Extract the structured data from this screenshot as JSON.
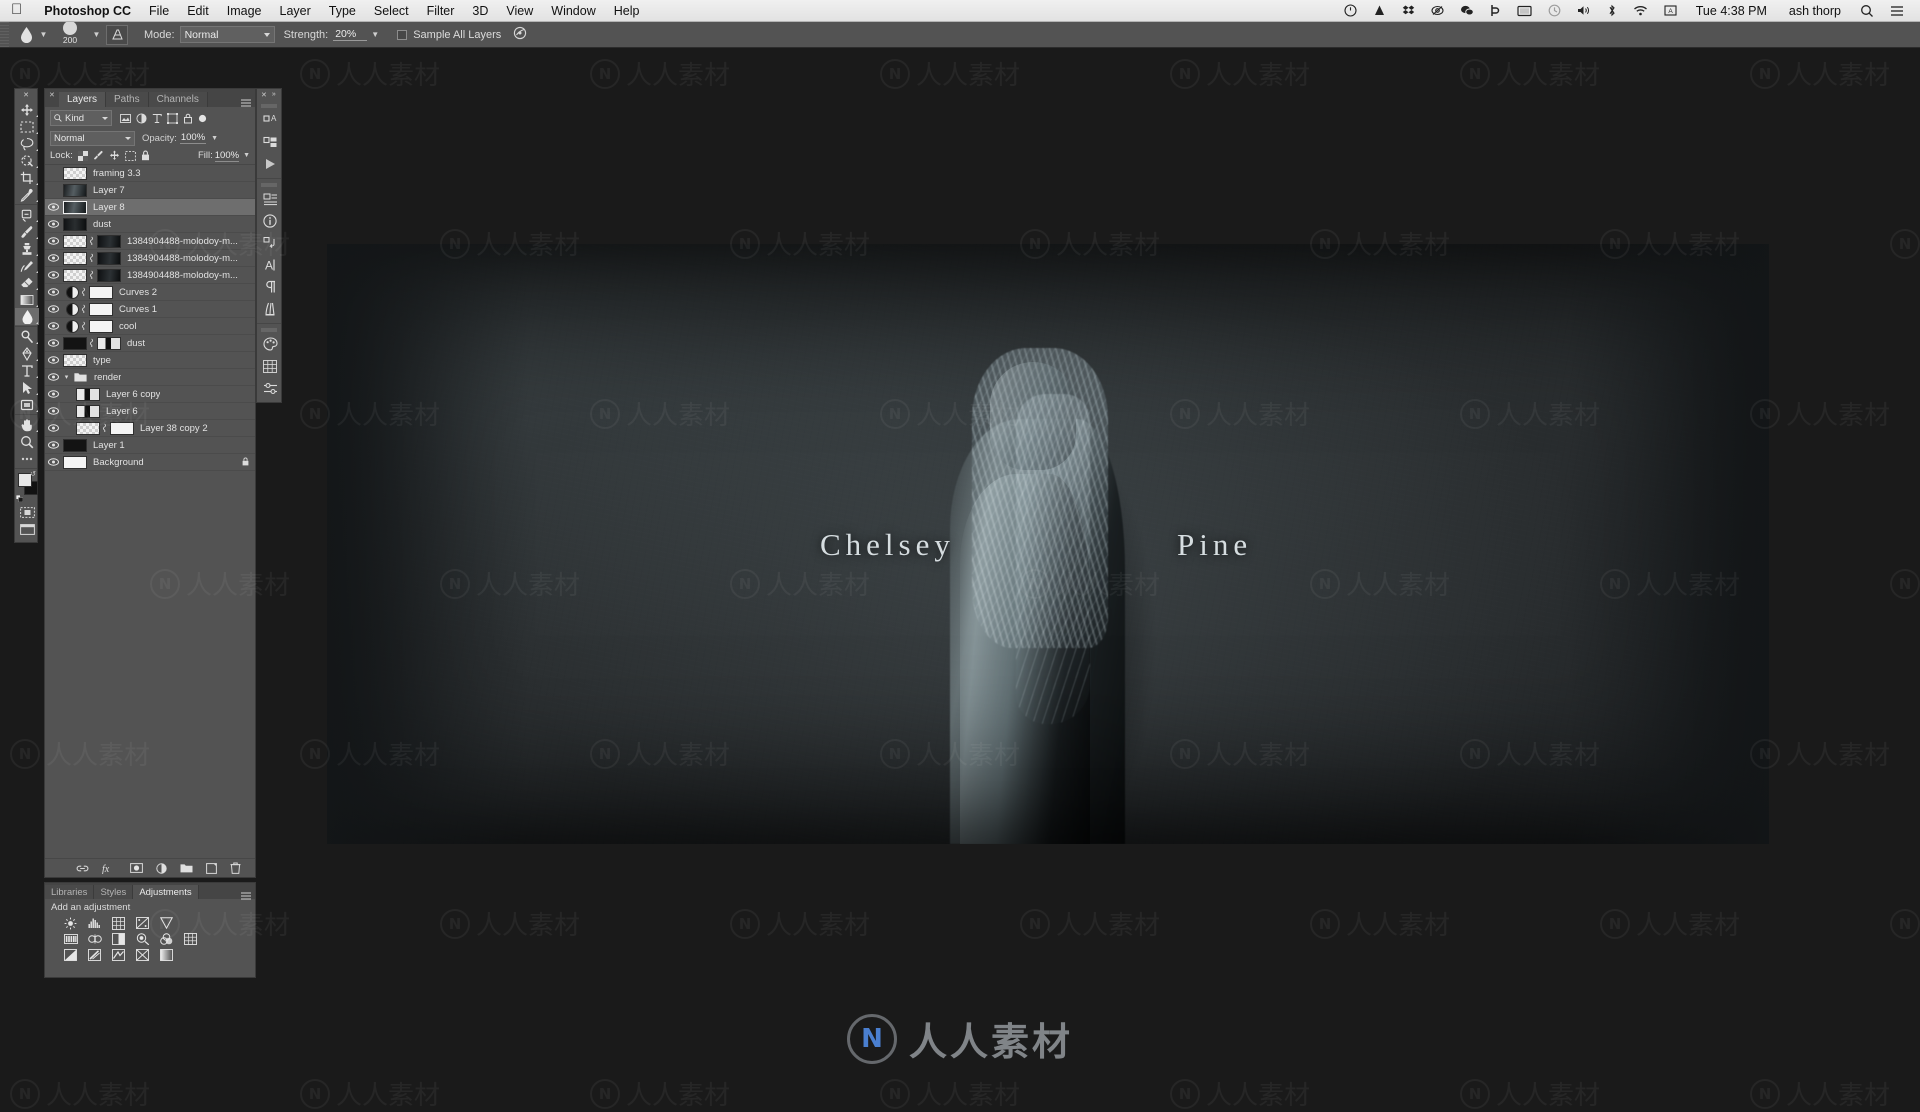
{
  "menubar": {
    "apple_icon": "apple-logo-icon",
    "items": [
      "Photoshop CC",
      "File",
      "Edit",
      "Image",
      "Layer",
      "Type",
      "Select",
      "Filter",
      "3D",
      "View",
      "Window",
      "Help"
    ],
    "status_icons": [
      "clock-badge-icon",
      "drive-icon",
      "dropbox-icon",
      "eye-slash-icon",
      "chat-bubbles-icon",
      "backblaze-b-icon",
      "display-icon",
      "timemachine-icon",
      "volume-icon",
      "bluetooth-icon",
      "wifi-icon",
      "input-source-icon"
    ],
    "clock": "Tue 4:38 PM",
    "user": "ash thorp",
    "search_icon": "search-icon",
    "notification_icon": "notification-center-icon"
  },
  "options_bar": {
    "tool_icon": "smudge-tool-icon",
    "brush_size": "200",
    "brush_preset_icon": "brush-preset-icon",
    "mode_label": "Mode:",
    "mode_value": "Normal",
    "strength_label": "Strength:",
    "strength_value": "20%",
    "sample_all_layers_label": "Sample All Layers",
    "sample_all_layers_checked": false,
    "airbrush_icon": "pressure-toggle-icon"
  },
  "tools": {
    "close_icon": "close-icon",
    "items": [
      {
        "name": "move-tool",
        "icon": "move-icon",
        "selected": false
      },
      {
        "name": "marquee-tool",
        "icon": "rectangular-marquee-icon",
        "selected": false
      },
      {
        "name": "lasso-tool",
        "icon": "lasso-icon",
        "selected": false
      },
      {
        "name": "quick-selection-tool",
        "icon": "quick-selection-icon",
        "selected": false
      },
      {
        "name": "crop-tool",
        "icon": "crop-icon",
        "selected": false
      },
      {
        "name": "eyedropper-tool",
        "icon": "eyedropper-icon",
        "selected": false
      },
      {
        "name": "spot-healing-tool",
        "icon": "spot-healing-brush-icon",
        "selected": false
      },
      {
        "name": "brush-tool",
        "icon": "paintbrush-icon",
        "selected": false
      },
      {
        "name": "clone-stamp-tool",
        "icon": "clone-stamp-icon",
        "selected": false
      },
      {
        "name": "history-brush-tool",
        "icon": "history-brush-icon",
        "selected": false
      },
      {
        "name": "eraser-tool",
        "icon": "eraser-icon",
        "selected": false
      },
      {
        "name": "gradient-tool",
        "icon": "gradient-icon",
        "selected": false
      },
      {
        "name": "smudge-tool",
        "icon": "smudge-drop-icon",
        "selected": true
      },
      {
        "name": "dodge-tool",
        "icon": "dodge-icon",
        "selected": false
      },
      {
        "name": "pen-tool",
        "icon": "pen-icon",
        "selected": false
      },
      {
        "name": "type-tool",
        "icon": "type-t-icon",
        "selected": false
      },
      {
        "name": "path-selection-tool",
        "icon": "path-arrow-icon",
        "selected": false
      },
      {
        "name": "shape-tool",
        "icon": "rectangle-shape-icon",
        "selected": false
      },
      {
        "name": "hand-tool",
        "icon": "hand-icon",
        "selected": false
      },
      {
        "name": "zoom-tool",
        "icon": "magnifier-icon",
        "selected": false
      },
      {
        "name": "edit-toolbar",
        "icon": "ellipsis-icon",
        "selected": false
      }
    ],
    "swap_colors_icon": "swap-colors-icon",
    "default_colors_icon": "default-colors-icon",
    "foreground_color": "#e8e8e8",
    "background_color": "#121212",
    "quick_mask_icon": "quick-mask-icon",
    "screen_mode_icon": "screen-mode-icon"
  },
  "layers_panel": {
    "tabs": [
      {
        "label": "Layers",
        "active": true
      },
      {
        "label": "Paths",
        "active": false
      },
      {
        "label": "Channels",
        "active": false
      }
    ],
    "filter": {
      "kind_label": "Kind",
      "search_icon": "search-icon",
      "type_icons": [
        "pixel-filter-icon",
        "adjustment-filter-icon",
        "type-filter-icon",
        "shape-filter-icon",
        "smart-object-filter-icon"
      ],
      "toggle_icon": "filter-toggle-icon"
    },
    "blend_mode": "Normal",
    "opacity_label": "Opacity:",
    "opacity_value": "100%",
    "lock_label": "Lock:",
    "lock_icons": [
      "lock-transparency-icon",
      "lock-image-icon",
      "lock-position-icon",
      "lock-artboard-icon",
      "lock-all-icon"
    ],
    "fill_label": "Fill:",
    "fill_value": "100%",
    "layers": [
      {
        "name": "framing 3.3",
        "visible": false,
        "selected": false,
        "type": "pixel",
        "thumb": "checker",
        "indent": 0
      },
      {
        "name": "Layer 7",
        "visible": false,
        "selected": false,
        "type": "pixel",
        "thumb": "dark",
        "indent": 0
      },
      {
        "name": "Layer 8",
        "visible": true,
        "selected": true,
        "type": "pixel",
        "thumb": "dark",
        "indent": 0
      },
      {
        "name": "dust",
        "visible": true,
        "selected": false,
        "type": "pixel",
        "thumb": "darker",
        "indent": 0
      },
      {
        "name": "1384904488-molodoy-m...",
        "visible": true,
        "selected": false,
        "type": "masked",
        "thumb": "checker",
        "mask": "darkmask",
        "indent": 0
      },
      {
        "name": "1384904488-molodoy-m...",
        "visible": true,
        "selected": false,
        "type": "masked",
        "thumb": "checker",
        "mask": "darkmask",
        "indent": 0
      },
      {
        "name": "1384904488-molodoy-m...",
        "visible": true,
        "selected": false,
        "type": "masked",
        "thumb": "checker",
        "mask": "darkmask",
        "indent": 0
      },
      {
        "name": "Curves 2",
        "visible": true,
        "selected": false,
        "type": "adjustment",
        "mask": "white",
        "indent": 0
      },
      {
        "name": "Curves 1",
        "visible": true,
        "selected": false,
        "type": "adjustment",
        "mask": "white",
        "indent": 0
      },
      {
        "name": "cool",
        "visible": true,
        "selected": false,
        "type": "adjustment",
        "mask": "white",
        "indent": 0
      },
      {
        "name": "dust",
        "visible": true,
        "selected": false,
        "type": "masked",
        "thumb": "black",
        "mask": "split",
        "indent": 0
      },
      {
        "name": "type",
        "visible": true,
        "selected": false,
        "type": "pixel",
        "thumb": "checker",
        "indent": 0
      },
      {
        "name": "render",
        "visible": true,
        "selected": false,
        "type": "group",
        "indent": 0
      },
      {
        "name": "Layer 6 copy",
        "visible": true,
        "selected": false,
        "type": "pixel",
        "thumb": "split",
        "indent": 1
      },
      {
        "name": "Layer 6",
        "visible": true,
        "selected": false,
        "type": "pixel",
        "thumb": "split",
        "indent": 1
      },
      {
        "name": "Layer 38 copy 2",
        "visible": true,
        "selected": false,
        "type": "masked",
        "thumb": "checker",
        "mask": "white",
        "indent": 1
      },
      {
        "name": "Layer 1",
        "visible": true,
        "selected": false,
        "type": "pixel",
        "thumb": "black",
        "indent": 0
      },
      {
        "name": "Background",
        "visible": true,
        "selected": false,
        "type": "pixel",
        "thumb": "white",
        "locked": true,
        "indent": 0
      }
    ],
    "bottom_buttons": [
      "link-layers-icon",
      "layer-style-fx-icon",
      "add-layer-mask-icon",
      "new-adjustment-layer-icon",
      "new-group-icon",
      "new-layer-icon",
      "delete-layer-icon"
    ]
  },
  "adjustments_panel": {
    "tabs": [
      {
        "label": "Libraries",
        "active": false
      },
      {
        "label": "Styles",
        "active": false
      },
      {
        "label": "Adjustments",
        "active": true
      }
    ],
    "title": "Add an adjustment",
    "row1": [
      "brightness-contrast-icon",
      "levels-icon",
      "curves-icon",
      "exposure-icon",
      "vibrance-icon"
    ],
    "row2": [
      "hue-saturation-icon",
      "color-balance-icon",
      "black-white-icon",
      "photo-filter-icon",
      "channel-mixer-icon",
      "color-lookup-icon"
    ],
    "row3": [
      "invert-icon",
      "posterize-icon",
      "threshold-icon",
      "selective-color-icon",
      "gradient-map-icon"
    ],
    "panel_menu_icon": "panel-menu-icon"
  },
  "dock": {
    "close_icon": "close-icon",
    "expand_icon": "expand-panels-icon",
    "group1": [
      "character-styles-icon",
      "layer-comps-icon",
      "timeline-play-icon"
    ],
    "group2": [
      "properties-icon",
      "info-icon",
      "history-icon",
      "character-icon",
      "paragraph-icon",
      "brush-presets-icon"
    ],
    "group3": [
      "color-palette-icon",
      "swatches-grid-icon",
      "adjust-sliders-icon"
    ]
  },
  "canvas": {
    "artwork_title_first": "Chelsey",
    "artwork_title_last": "Pine",
    "background_color": "#1a1a1a"
  },
  "watermarks": {
    "tile_text": "人人素材",
    "logo_letter": "N",
    "bottom_text": "人人素材"
  }
}
